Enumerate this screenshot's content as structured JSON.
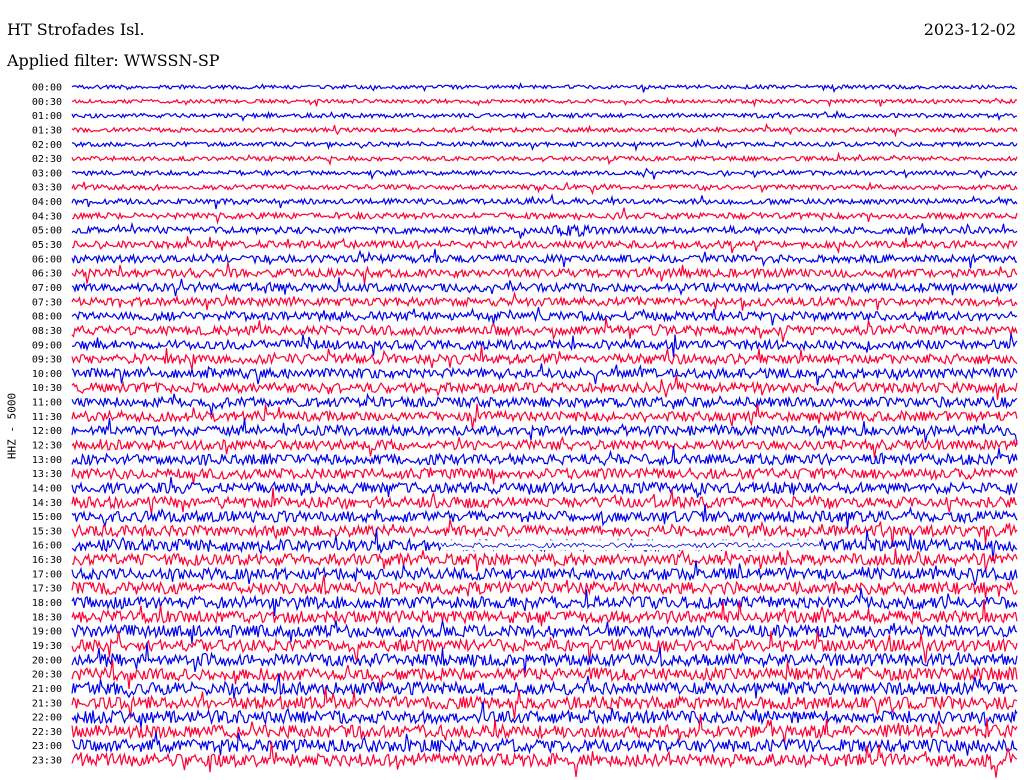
{
  "header": {
    "station": "HT Strofades Isl.",
    "date": "2023-12-02",
    "filter_text": "Applied filter: WWSSN-SP"
  },
  "channel_label": "HHZ - 5000",
  "chart_data": {
    "type": "line",
    "title": "HT Strofades Isl.",
    "date": "2023-12-02",
    "filter": "WWSSN-SP",
    "ylabel": "HHZ - 5000",
    "trace_colors": [
      "#0000ee",
      "#ff0033"
    ],
    "row_labels": [
      "00:00",
      "00:30",
      "01:00",
      "01:30",
      "02:00",
      "02:30",
      "03:00",
      "03:30",
      "04:00",
      "04:30",
      "05:00",
      "05:30",
      "06:00",
      "06:30",
      "07:00",
      "07:30",
      "08:00",
      "08:30",
      "09:00",
      "09:30",
      "10:00",
      "10:30",
      "11:00",
      "11:30",
      "12:00",
      "12:30",
      "13:00",
      "13:30",
      "14:00",
      "14:30",
      "15:00",
      "15:30",
      "16:00",
      "16:30",
      "17:00",
      "17:30",
      "18:00",
      "18:30",
      "19:00",
      "19:30",
      "20:00",
      "20:30",
      "21:00",
      "21:30",
      "22:00",
      "22:30",
      "23:00",
      "23:30"
    ],
    "relative_amplitude": [
      0.35,
      0.35,
      0.4,
      0.4,
      0.4,
      0.4,
      0.42,
      0.45,
      0.5,
      0.55,
      0.6,
      0.65,
      0.7,
      0.75,
      0.75,
      0.75,
      0.8,
      0.85,
      0.85,
      0.9,
      0.9,
      0.9,
      0.9,
      0.9,
      0.9,
      0.9,
      0.95,
      0.95,
      1.0,
      1.0,
      1.0,
      1.0,
      1.05,
      1.05,
      1.05,
      1.1,
      1.1,
      1.1,
      1.1,
      1.1,
      1.15,
      1.15,
      1.15,
      1.15,
      1.15,
      1.15,
      1.15,
      1.15
    ],
    "events": [
      {
        "row": "05:00",
        "start_fraction": 0.5,
        "end_fraction": 0.56,
        "amplitude": 2.0
      }
    ],
    "quiet_segments": [
      {
        "row": "16:00",
        "start_fraction": 0.39,
        "end_fraction": 0.79
      }
    ]
  }
}
